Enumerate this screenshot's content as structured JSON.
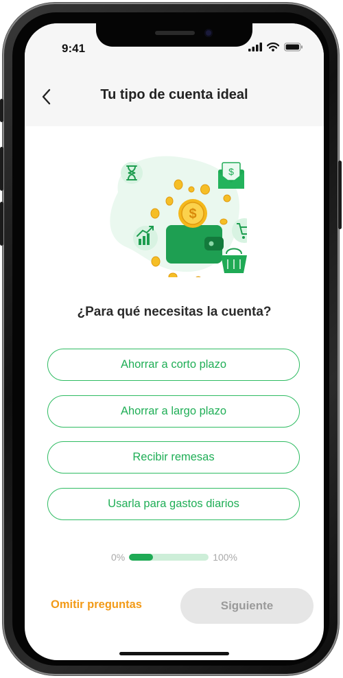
{
  "status_bar": {
    "time": "9:41"
  },
  "header": {
    "title": "Tu tipo de cuenta ideal",
    "back_icon": "chevron-left-icon"
  },
  "illustration": {
    "coin_symbol": "$",
    "envelope_symbol": "$",
    "icons": [
      "hourglass-icon",
      "money-envelope-icon",
      "growth-chart-icon",
      "shopping-cart-icon",
      "basket-icon",
      "wallet-icon",
      "coin-icon"
    ]
  },
  "question": "¿Para qué necesitas la cuenta?",
  "options": [
    {
      "label": "Ahorrar a corto plazo"
    },
    {
      "label": "Ahorrar a largo plazo"
    },
    {
      "label": "Recibir remesas"
    },
    {
      "label": "Usarla para gastos diarios"
    }
  ],
  "progress": {
    "min_label": "0%",
    "max_label": "100%",
    "value": 0.3
  },
  "footer": {
    "skip_label": "Omitir preguntas",
    "next_label": "Siguiente"
  },
  "colors": {
    "accent_green": "#1fae56",
    "skip_orange": "#f29a17",
    "disabled_button": "#e6e6e6"
  }
}
